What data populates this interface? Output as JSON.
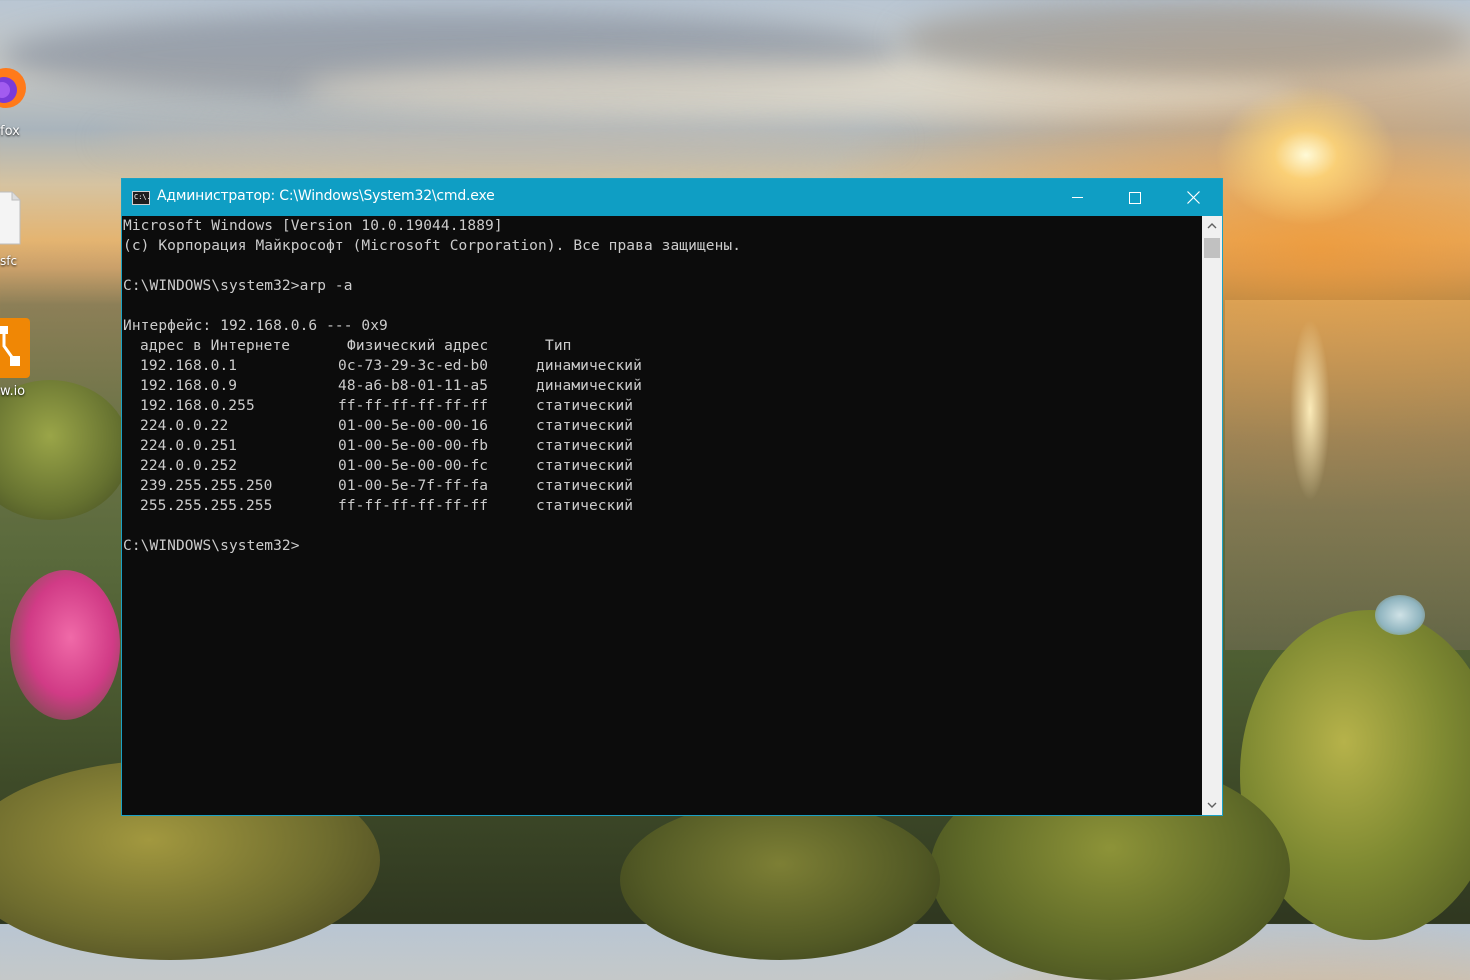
{
  "desktop": {
    "icons": [
      {
        "label": "fox",
        "icon": "firefox-icon"
      },
      {
        "label": "sfc",
        "icon": "file-icon"
      },
      {
        "label": "w.io",
        "icon": "drawio-icon"
      }
    ]
  },
  "window": {
    "title": "Администратор: C:\\Windows\\System32\\cmd.exe",
    "app_icon_text": "C:\\.",
    "accent_color": "#0f9ec4",
    "controls": {
      "minimize": "minimize-icon",
      "maximize": "maximize-icon",
      "close": "close-icon"
    }
  },
  "console": {
    "header": [
      "Microsoft Windows [Version 10.0.19044.1889]",
      "(c) Корпорация Майкрософт (Microsoft Corporation). Все права защищены."
    ],
    "prompt": "C:\\WINDOWS\\system32>",
    "command": "arp -a",
    "interface_line": "Интерфейс: 192.168.0.6 --- 0x9",
    "columns": [
      "адрес в Интернете",
      "Физический адрес",
      "Тип"
    ],
    "rows": [
      {
        "ip": "192.168.0.1",
        "mac": "0c-73-29-3c-ed-b0",
        "type": "динамический"
      },
      {
        "ip": "192.168.0.9",
        "mac": "48-a6-b8-01-11-a5",
        "type": "динамический"
      },
      {
        "ip": "192.168.0.255",
        "mac": "ff-ff-ff-ff-ff-ff",
        "type": "статический"
      },
      {
        "ip": "224.0.0.22",
        "mac": "01-00-5e-00-00-16",
        "type": "статический"
      },
      {
        "ip": "224.0.0.251",
        "mac": "01-00-5e-00-00-fb",
        "type": "статический"
      },
      {
        "ip": "224.0.0.252",
        "mac": "01-00-5e-00-00-fc",
        "type": "статический"
      },
      {
        "ip": "239.255.255.250",
        "mac": "01-00-5e-7f-ff-fa",
        "type": "статический"
      },
      {
        "ip": "255.255.255.255",
        "mac": "ff-ff-ff-ff-ff-ff",
        "type": "статический"
      }
    ],
    "final_prompt": "C:\\WINDOWS\\system32>"
  }
}
